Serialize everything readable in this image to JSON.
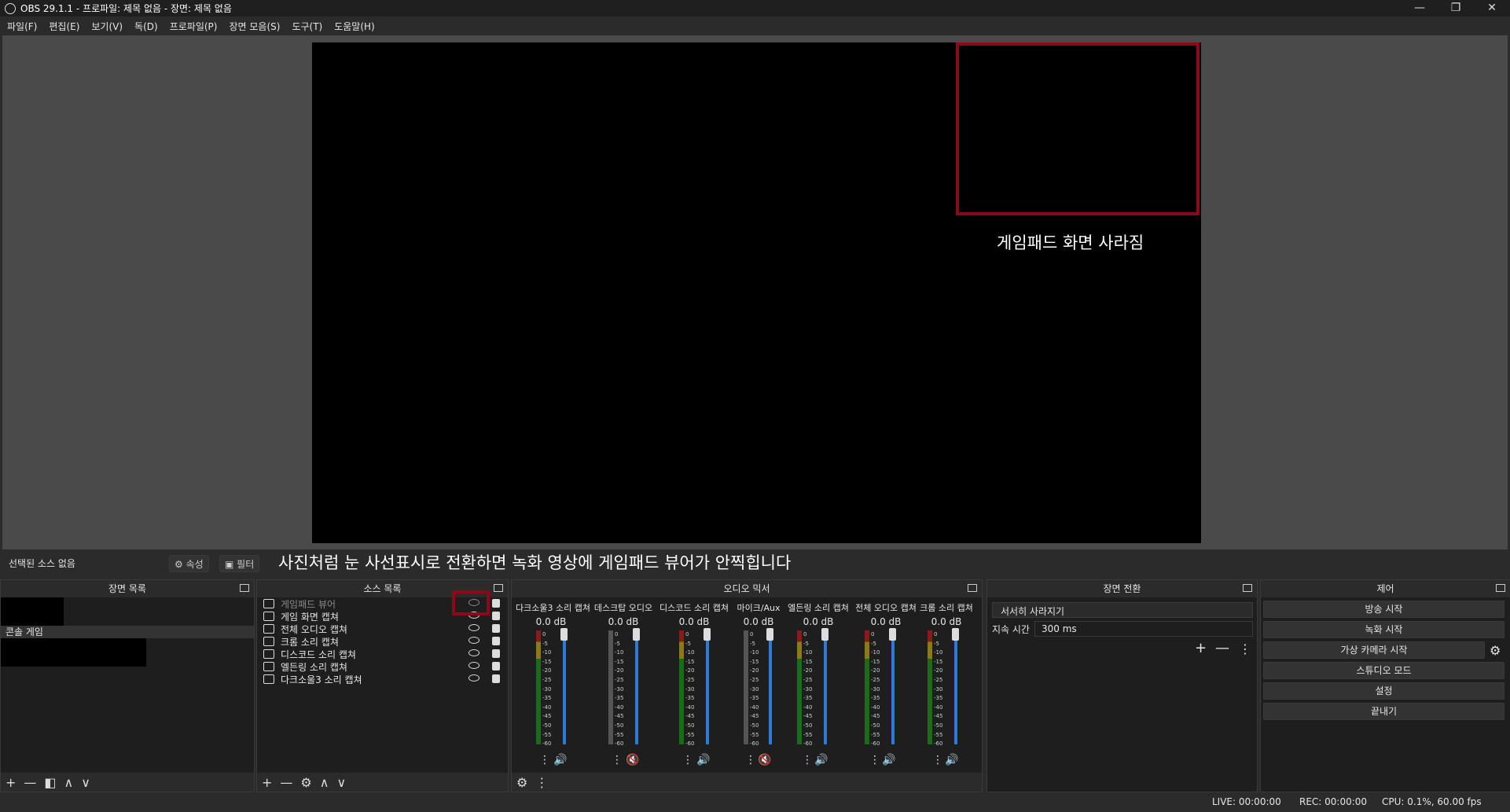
{
  "window": {
    "title": "OBS 29.1.1 - 프로파일: 제목 없음 - 장면: 제목 없음",
    "minimize": "—",
    "restore": "❐",
    "close": "✕"
  },
  "menu": [
    "파일(F)",
    "편집(E)",
    "보기(V)",
    "독(D)",
    "프로파일(P)",
    "장면 모음(S)",
    "도구(T)",
    "도움말(H)"
  ],
  "annotations": {
    "top": "게임패드 화면 사라짐",
    "bottom": "사진처럼 눈 사선표시로 전환하면 녹화 영상에 게임패드 뷰어가 안찍힙니다"
  },
  "context": {
    "no_selection": "선택된 소스 없음",
    "properties": "⚙ 속성",
    "filters": "▣ 필터"
  },
  "docks": {
    "scenes": "장면 목록",
    "sources": "소스 목록",
    "mixer": "오디오 믹서",
    "transitions": "장면 전환",
    "controls": "제어"
  },
  "scenes": [
    "",
    "콘솔 게임",
    ""
  ],
  "sources": [
    {
      "name": "게임패드 뷰어",
      "hidden": true
    },
    {
      "name": "게임 화면 캡쳐",
      "hidden": false
    },
    {
      "name": "전체 오디오 캡쳐",
      "hidden": false
    },
    {
      "name": "크롬 소리 캡쳐",
      "hidden": false
    },
    {
      "name": "디스코드 소리 캡쳐",
      "hidden": false
    },
    {
      "name": "엘든링 소리 캡쳐",
      "hidden": false
    },
    {
      "name": "다크소울3 소리 캡쳐",
      "hidden": false
    }
  ],
  "mixer": [
    {
      "name": "다크소울3 소리 캡쳐",
      "db": "0.0 dB",
      "muted": false
    },
    {
      "name": "데스크탑 오디오",
      "db": "0.0 dB",
      "muted": true
    },
    {
      "name": "디스코드 소리 캡쳐",
      "db": "0.0 dB",
      "muted": false
    },
    {
      "name": "마이크/Aux",
      "db": "0.0 dB",
      "muted": true
    },
    {
      "name": "엘든링 소리 캡쳐",
      "db": "0.0 dB",
      "muted": false
    },
    {
      "name": "전체 오디오 캡쳐",
      "db": "0.0 dB",
      "muted": false
    },
    {
      "name": "크롬 소리 캡쳐",
      "db": "0.0 dB",
      "muted": false
    }
  ],
  "meter_ticks": [
    "0",
    "-5",
    "-10",
    "-15",
    "-20",
    "-25",
    "-30",
    "-35",
    "-40",
    "-45",
    "-50",
    "-55",
    "-60"
  ],
  "transitions": {
    "selected": "서서히 사라지기",
    "duration_label": "지속 시간",
    "duration_value": "300 ms"
  },
  "controls": [
    "방송 시작",
    "녹화 시작",
    "가상 카메라 시작",
    "스튜디오 모드",
    "설정",
    "끝내기"
  ],
  "status": {
    "live": "LIVE: 00:00:00",
    "rec": "REC: 00:00:00",
    "cpu": "CPU: 0.1%, 60.00 fps"
  },
  "toolbar_glyphs": {
    "add": "+",
    "remove": "—",
    "filter": "◧",
    "up": "∧",
    "down": "∨",
    "gear": "⚙",
    "more": "⋮"
  }
}
